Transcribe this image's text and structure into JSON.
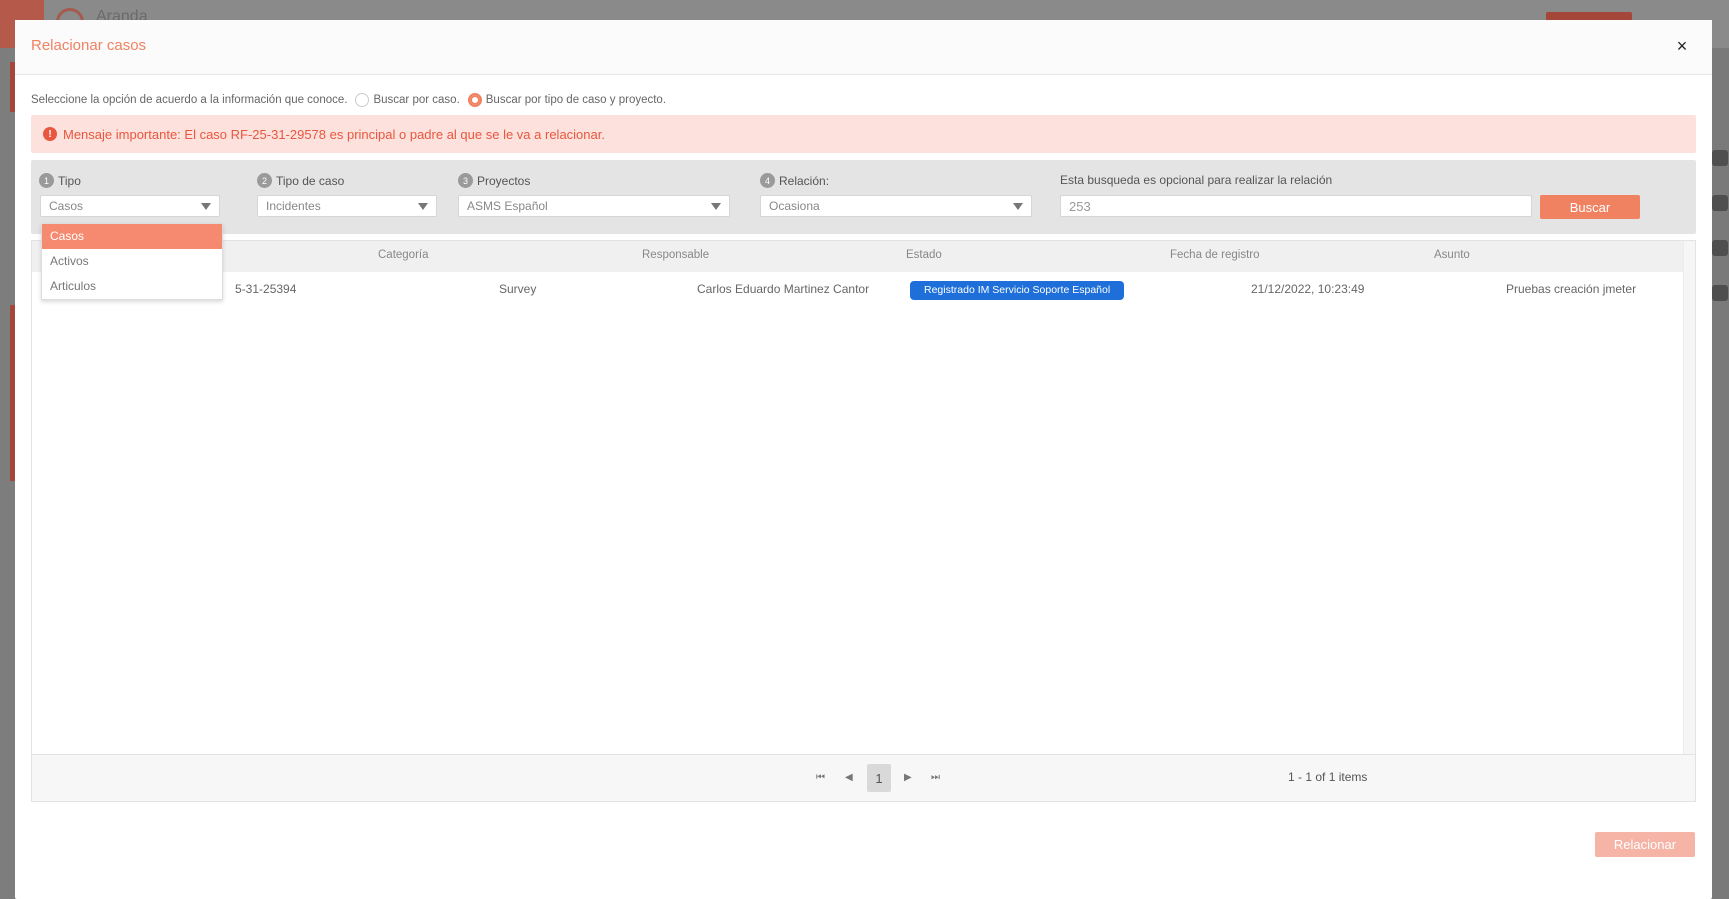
{
  "background": {
    "brand": "Aranda"
  },
  "modal": {
    "title": "Relacionar casos",
    "close_label": "×"
  },
  "options": {
    "prompt": "Seleccione la opción de acuerdo a la información que conoce.",
    "radio_by_case": "Buscar por caso.",
    "radio_by_type": "Buscar por tipo de caso y proyecto.",
    "selected": "radio_by_type"
  },
  "alert": {
    "icon": "!",
    "message": "Mensaje importante: El caso RF-25-31-29578 es principal o padre al que se le va a relacionar."
  },
  "filters": {
    "tipo": {
      "step": "1",
      "label": "Tipo",
      "value": "Casos"
    },
    "tipo_caso": {
      "step": "2",
      "label": "Tipo de caso",
      "value": "Incidentes"
    },
    "proyectos": {
      "step": "3",
      "label": "Proyectos",
      "value": "ASMS Español"
    },
    "relacion": {
      "step": "4",
      "label": "Relación:",
      "value": "Ocasiona"
    },
    "search": {
      "label": "Esta busqueda es opcional para realizar la relación",
      "value": "253"
    },
    "search_button": "Buscar"
  },
  "dropdown": {
    "items": [
      "Casos",
      "Activos",
      "Articulos"
    ],
    "selected_index": 0
  },
  "grid": {
    "columns": [
      "Categoría",
      "Responsable",
      "Estado",
      "Fecha de registro",
      "Asunto"
    ],
    "rows": [
      {
        "id": "5-31-25394",
        "categoria": "Survey",
        "responsable": "Carlos Eduardo Martinez Cantor",
        "estado": "Registrado IM Servicio Soporte Español",
        "fecha": "21/12/2022, 10:23:49",
        "asunto": "Pruebas creación jmeter"
      }
    ]
  },
  "pager": {
    "current_page": "1",
    "info": "1 - 1 of 1 items"
  },
  "footer": {
    "relate_button": "Relacionar"
  },
  "colors": {
    "accent": "#f08262",
    "status": "#1e6fd9",
    "alert_bg": "#fde1dc"
  }
}
